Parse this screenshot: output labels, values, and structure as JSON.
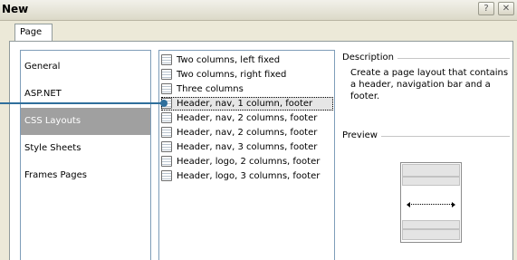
{
  "window": {
    "title": "New",
    "help_glyph": "?",
    "close_glyph": "✕"
  },
  "tabs": [
    {
      "label": "Page"
    }
  ],
  "categories": {
    "items": [
      {
        "label": "General"
      },
      {
        "label": "ASP.NET"
      },
      {
        "label": "CSS Layouts"
      },
      {
        "label": "Style Sheets"
      },
      {
        "label": "Frames Pages"
      }
    ],
    "selected": "CSS Layouts"
  },
  "layouts": {
    "items": [
      {
        "label": "Two columns, left fixed"
      },
      {
        "label": "Two columns, right fixed"
      },
      {
        "label": "Three columns"
      },
      {
        "label": "Header, nav, 1 column, footer"
      },
      {
        "label": "Header, nav, 2 columns, footer"
      },
      {
        "label": "Header, nav, 2 columns, footer"
      },
      {
        "label": "Header, nav, 3 columns, footer"
      },
      {
        "label": "Header, logo, 2 columns, footer"
      },
      {
        "label": "Header, logo, 3 columns, footer"
      }
    ],
    "selected": "Header, nav, 1 column, footer",
    "icon": "page-layout-icon"
  },
  "description": {
    "label": "Description",
    "text": "Create a page layout that contains a header, navigation bar and a footer."
  },
  "preview": {
    "label": "Preview"
  },
  "colors": {
    "selection_bg": "#a0a0a0",
    "callout_line": "#2f6f9c",
    "dialog_bg": "#ece9d8"
  }
}
